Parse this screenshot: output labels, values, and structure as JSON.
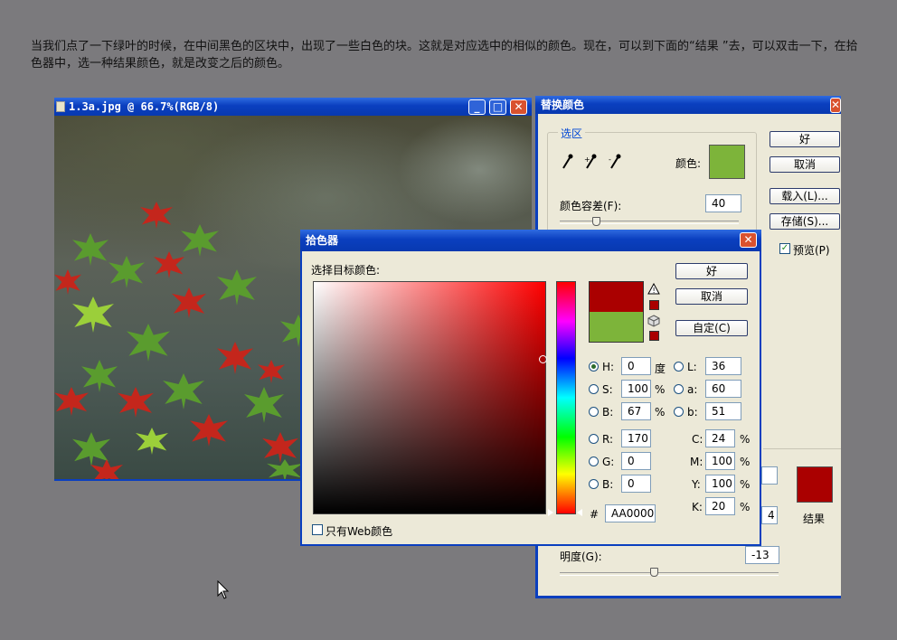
{
  "intro_text": "当我们点了一下绿叶的时候，在中间黑色的区块中，出现了一些白色的块。这就是对应选中的相似的颜色。现在，可以到下面的“结果 ”去，可以双击一下，在拾色器中，选一种结果颜色，就是改变之后的颜色。",
  "image_window": {
    "title": "1.3a.jpg @ 66.7%(RGB/8)",
    "minimize_glyph": "_",
    "maximize_glyph": "□",
    "close_glyph": "✕"
  },
  "replace_color": {
    "title": "替换颜色",
    "close_glyph": "✕",
    "selection_group": "选区",
    "color_label": "颜色:",
    "selection_color": "#7db43a",
    "fuzziness_label": "颜色容差(F):",
    "fuzziness_value": "40",
    "ok": "好",
    "cancel": "取消",
    "load": "载入(L)...",
    "save": "存储(S)...",
    "preview_label": "预览(P)",
    "preview_checked": "✓",
    "hidden_field_a": "",
    "hidden_field_b": "4",
    "result_label": "结果",
    "result_color": "#aa0000",
    "lightness_label": "明度(G):",
    "lightness_value": "-13"
  },
  "color_picker": {
    "title": "拾色器",
    "close_glyph": "✕",
    "select_label": "选择目标颜色:",
    "new_color": "#aa0000",
    "current_color": "#7db43a",
    "accent_red": "#aa0000",
    "ok": "好",
    "cancel": "取消",
    "custom": "自定(C)",
    "hsb": [
      {
        "label": "H:",
        "value": "0",
        "unit": "度",
        "selected": true
      },
      {
        "label": "S:",
        "value": "100",
        "unit": "%",
        "selected": false
      },
      {
        "label": "B:",
        "value": "67",
        "unit": "%",
        "selected": false
      }
    ],
    "lab": [
      {
        "label": "L:",
        "value": "36"
      },
      {
        "label": "a:",
        "value": "60"
      },
      {
        "label": "b:",
        "value": "51"
      }
    ],
    "rgb": [
      {
        "label": "R:",
        "value": "170"
      },
      {
        "label": "G:",
        "value": "0"
      },
      {
        "label": "B:",
        "value": "0"
      }
    ],
    "cmyk": [
      {
        "label": "C:",
        "value": "24",
        "unit": "%"
      },
      {
        "label": "M:",
        "value": "100",
        "unit": "%"
      },
      {
        "label": "Y:",
        "value": "100",
        "unit": "%"
      },
      {
        "label": "K:",
        "value": "20",
        "unit": "%"
      }
    ],
    "hex_label": "#",
    "hex_value": "AA0000",
    "web_only_label": "只有Web颜色"
  }
}
